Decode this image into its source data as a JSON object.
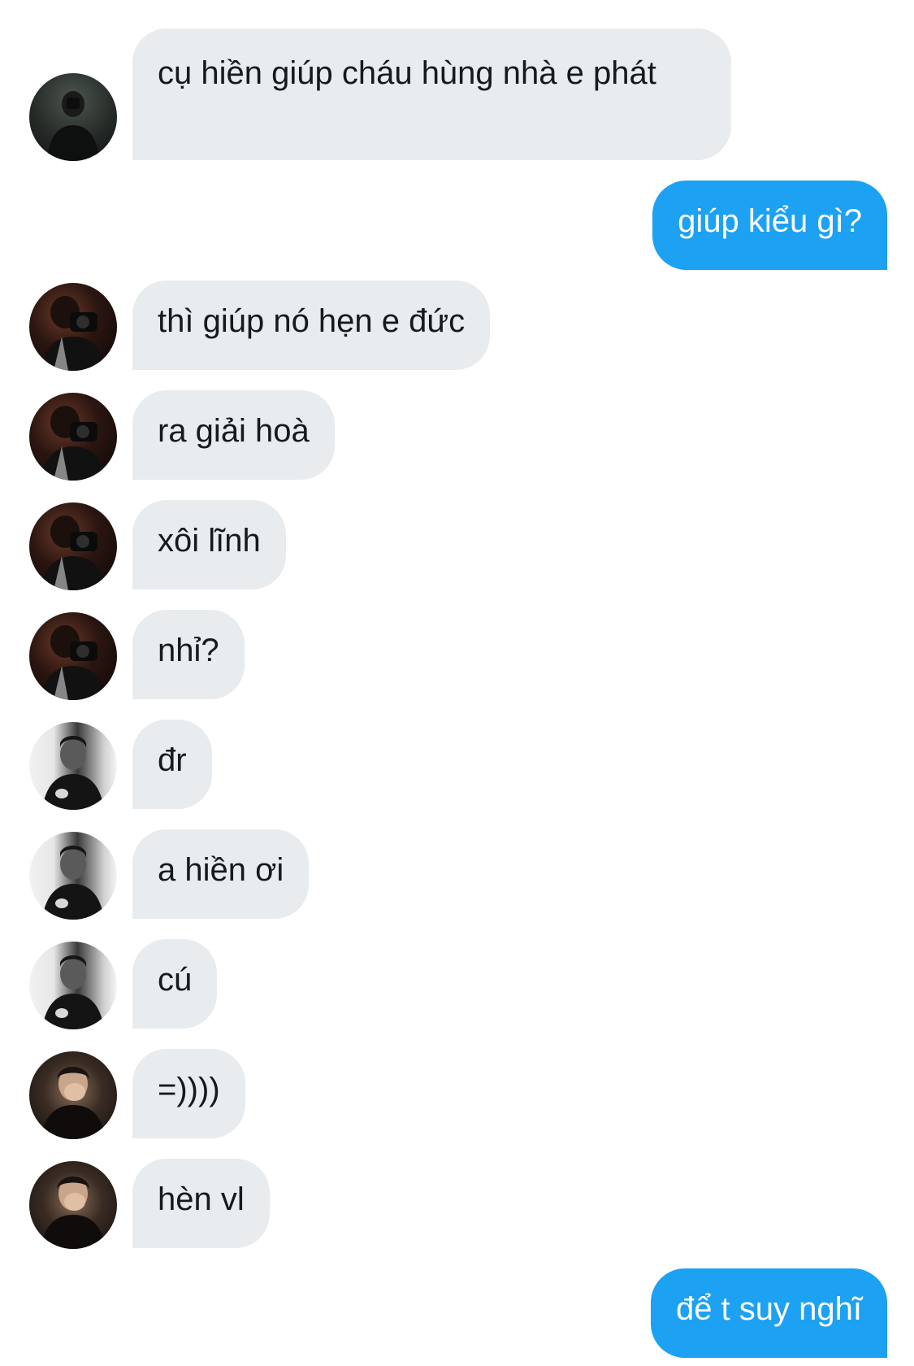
{
  "conversation": {
    "messages": [
      {
        "sender": "them",
        "text": "cụ hiền giúp cháu hùng nhà e phát",
        "avatar_icon": "user-avatar-icon"
      },
      {
        "sender": "me",
        "text": "giúp kiểu gì?"
      },
      {
        "sender": "them",
        "text": "thì giúp nó hẹn e đức",
        "avatar_icon": "user-avatar-icon"
      },
      {
        "sender": "them",
        "text": "ra giải hoà",
        "avatar_icon": "user-avatar-icon"
      },
      {
        "sender": "them",
        "text": "xôi lĩnh",
        "avatar_icon": "user-avatar-icon"
      },
      {
        "sender": "them",
        "text": "nhỉ?",
        "avatar_icon": "user-avatar-icon"
      },
      {
        "sender": "them",
        "text": "đr",
        "avatar_icon": "user-avatar-icon"
      },
      {
        "sender": "them",
        "text": "a hiền ơi",
        "avatar_icon": "user-avatar-icon"
      },
      {
        "sender": "them",
        "text": "cú",
        "avatar_icon": "user-avatar-icon"
      },
      {
        "sender": "them",
        "text": "=))))",
        "avatar_icon": "user-avatar-icon"
      },
      {
        "sender": "them",
        "text": "hèn vl",
        "avatar_icon": "user-avatar-icon"
      },
      {
        "sender": "me",
        "text": "để t suy nghĩ"
      }
    ]
  },
  "colors": {
    "incoming_bubble": "#e8ecef",
    "incoming_text": "#141a1f",
    "outgoing_bubble": "#1da1f2",
    "outgoing_text": "#ffffff",
    "background": "#ffffff"
  }
}
